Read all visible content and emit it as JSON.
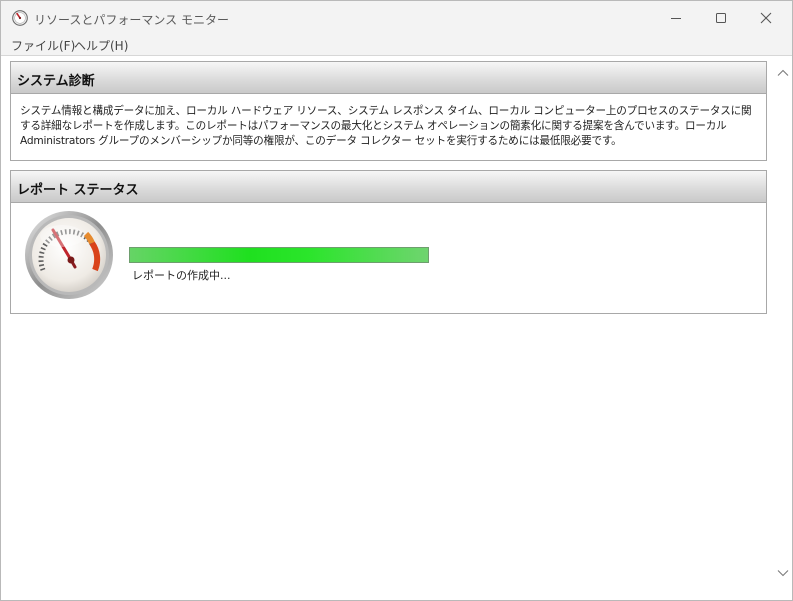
{
  "window": {
    "title": "リソースとパフォーマンス モニター",
    "app_icon": "resource-monitor-icon"
  },
  "menubar": {
    "file_label": "ファイル(F)",
    "help_label": "ヘルプ(H)"
  },
  "diagnostics": {
    "title": "システム診断",
    "description": "システム情報と構成データに加え、ローカル ハードウェア リソース、システム レスポンス タイム、ローカル コンピューター上のプロセスのステータスに関する詳細なレポートを作成します。このレポートはパフォーマンスの最大化とシステム オペレーションの簡素化に関する提案を含んでいます。ローカル Administrators グループのメンバーシップか同等の権限が、このデータ コレクター セットを実行するためには最低限必要です。"
  },
  "report": {
    "title": "レポート ステータス",
    "status_text": "レポートの作成中...",
    "progress_fraction": 1.0,
    "gauge_icon": "performance-gauge-icon"
  },
  "colors": {
    "progress_green": "#1fe01f",
    "gauge_needle": "#c0262d",
    "titlebar_bg": "#f3f3f3"
  }
}
